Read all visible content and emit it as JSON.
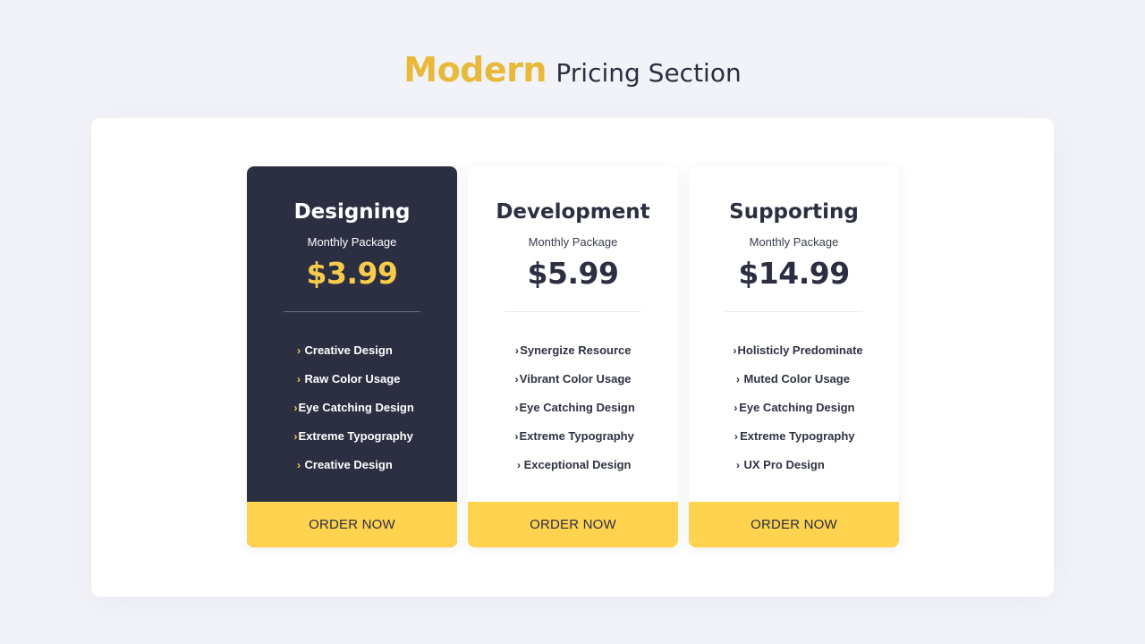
{
  "heading": {
    "accent": "Modern",
    "rest": "Pricing Section"
  },
  "colors": {
    "accent_yellow": "#ffd24f",
    "title_gold": "#e8b93a",
    "dark_card": "#2b2f41",
    "page_bg": "#f2f3f8"
  },
  "plans": [
    {
      "title": "Designing",
      "subtitle": "Monthly Package",
      "price": "$3.99",
      "featured": true,
      "features": [
        "Creative Design",
        "Raw Color Usage",
        "Eye Catching Design",
        "Extreme Typography",
        "Creative Design"
      ],
      "button": "ORDER NOW"
    },
    {
      "title": "Development",
      "subtitle": "Monthly Package",
      "price": "$5.99",
      "featured": false,
      "features": [
        "Synergize Resource",
        "Vibrant Color Usage",
        "Eye Catching Design",
        "Extreme Typography",
        "Exceptional Design"
      ],
      "button": "ORDER NOW"
    },
    {
      "title": "Supporting",
      "subtitle": "Monthly Package",
      "price": "$14.99",
      "featured": false,
      "features": [
        "Holisticly Predominate",
        "Muted Color Usage",
        "Eye Catching Design",
        "Extreme Typography",
        "UX Pro Design"
      ],
      "button": "ORDER NOW"
    }
  ],
  "icons": {
    "feature_bullet": "chevron-right-icon",
    "glyph": "›"
  }
}
